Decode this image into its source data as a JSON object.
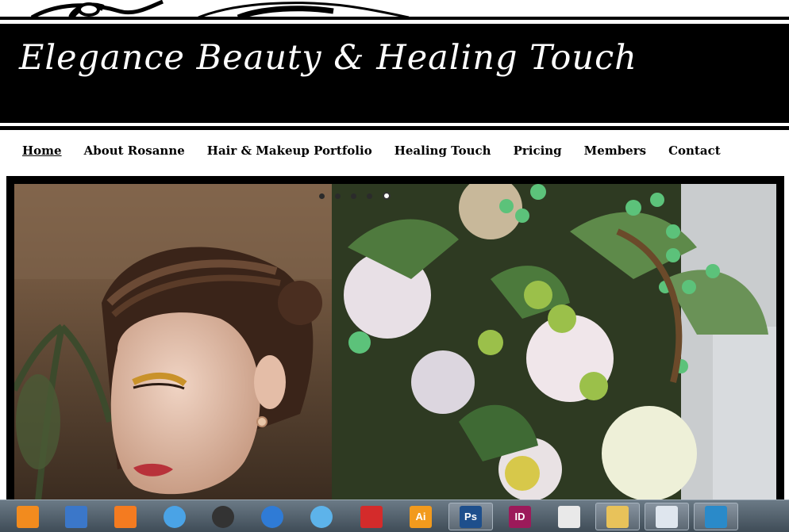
{
  "site": {
    "title": "Elegance Beauty & Healing Touch"
  },
  "nav": [
    {
      "label": "Home",
      "active": true
    },
    {
      "label": "About Rosanne",
      "active": false
    },
    {
      "label": "Hair & Makeup Portfolio",
      "active": false
    },
    {
      "label": "Healing Touch",
      "active": false
    },
    {
      "label": "Pricing",
      "active": false
    },
    {
      "label": "Members",
      "active": false
    },
    {
      "label": "Contact",
      "active": false
    }
  ],
  "slideshow": {
    "slide_count": 5,
    "active_slide": 5
  },
  "taskbar": {
    "icons": [
      {
        "name": "avast-icon",
        "text": "",
        "color": "#f28b1e"
      },
      {
        "name": "network-settings-icon",
        "text": "",
        "color": "#3b77c9"
      },
      {
        "name": "vlc-icon",
        "text": "",
        "color": "#f47b20"
      },
      {
        "name": "itunes-icon",
        "text": "",
        "color": "#4aa3e6"
      },
      {
        "name": "sheep-icon",
        "text": "",
        "color": "#333333"
      },
      {
        "name": "thunderbird-icon",
        "text": "",
        "color": "#2f7bd6"
      },
      {
        "name": "snowflake-icon",
        "text": "",
        "color": "#5db3ea"
      },
      {
        "name": "acrobat-icon",
        "text": "",
        "color": "#d42b2b"
      },
      {
        "name": "illustrator-icon",
        "text": "Ai",
        "color": "#f29a1d"
      },
      {
        "name": "photoshop-icon",
        "text": "Ps",
        "color": "#1e4f8c"
      },
      {
        "name": "indesign-icon",
        "text": "ID",
        "color": "#9c1a5a"
      },
      {
        "name": "document-viewer-icon",
        "text": "",
        "color": "#e9e9e9"
      },
      {
        "name": "file-explorer-icon",
        "text": "",
        "color": "#e8c25a"
      },
      {
        "name": "odf-document-icon",
        "text": "",
        "color": "#dfe6ee"
      },
      {
        "name": "app-frame-icon",
        "text": "",
        "color": "#2a8ac9"
      }
    ]
  }
}
